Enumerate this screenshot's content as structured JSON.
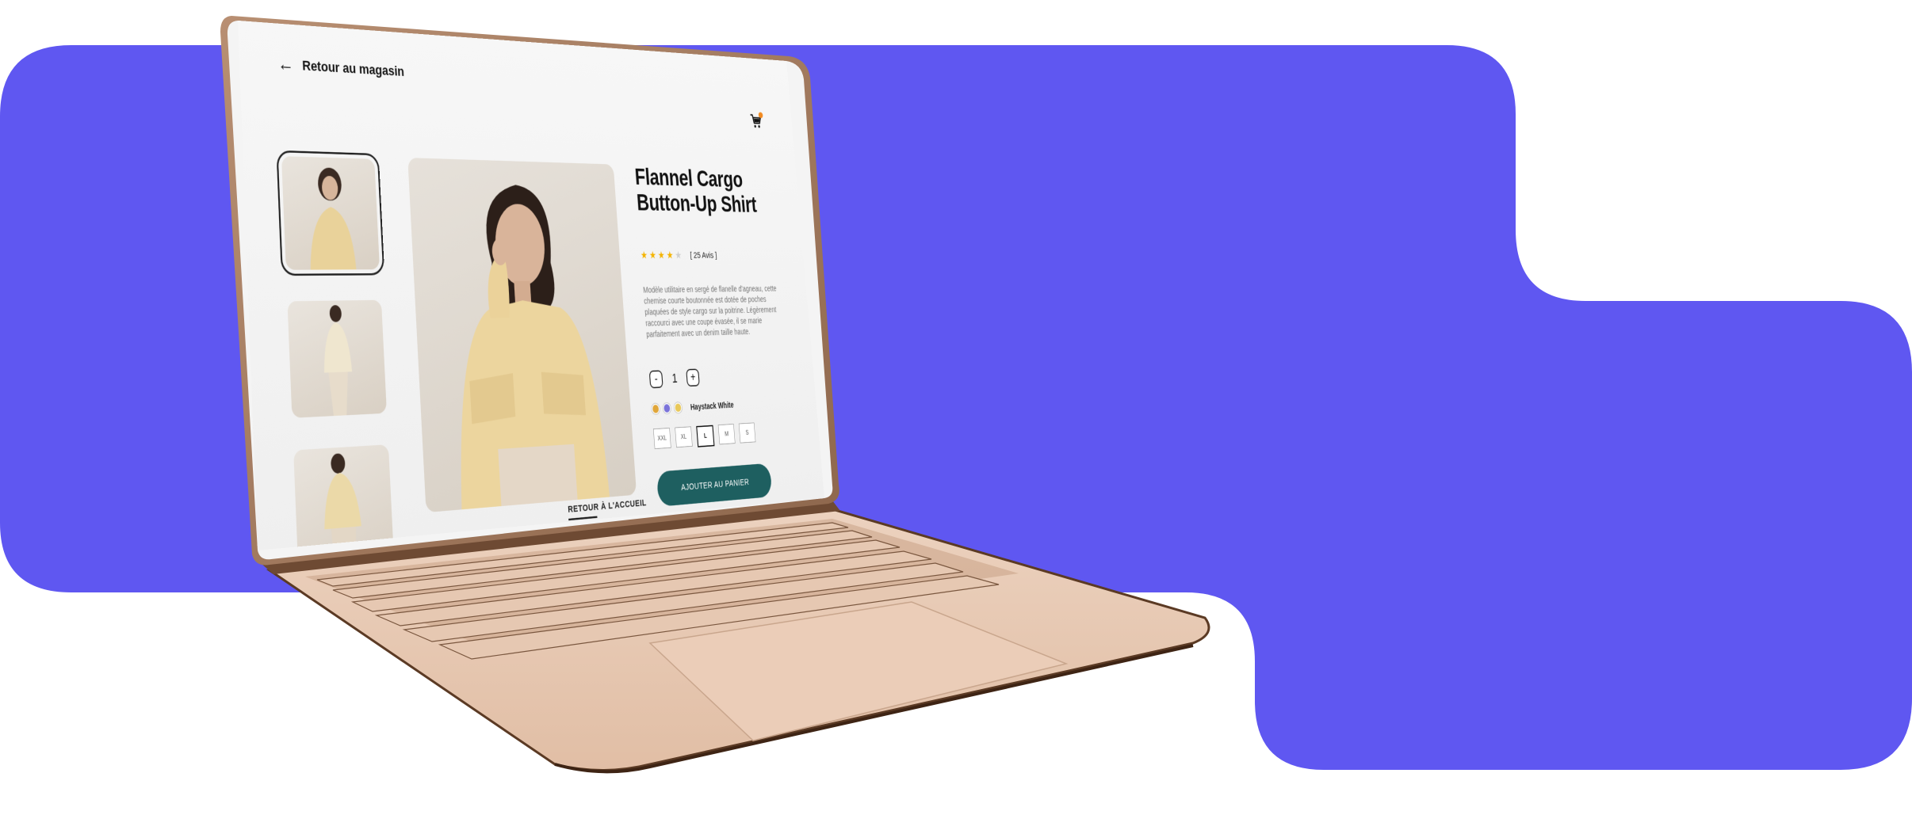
{
  "header": {
    "back_label": "Retour au magasin",
    "back_icon": "arrow-left-icon",
    "cart_icon": "shopping-cart-icon"
  },
  "product": {
    "title": "Flannel Cargo Button-Up Shirt",
    "rating": 4,
    "rating_max": 5,
    "reviews_label": "[ 25 Avis ]",
    "description": "Modèle utilitaire en sergé de flanelle d'agneau, cette chemise courte boutonnée est dotée de poches plaquées de style cargo sur la poitrine. Légèrement raccourci avec une coupe évasée, il se marie parfaitement avec un denim taille haute.",
    "quantity": "1",
    "qty_minus": "-",
    "qty_plus": "+",
    "colors": [
      "#e0a63a",
      "#7a73d9",
      "#e8c85a"
    ],
    "color_name": "Haystack White",
    "sizes": [
      "XXL",
      "XL",
      "L",
      "M",
      "S"
    ],
    "selected_size": "L",
    "add_to_cart_label": "AJOUTER AU PANIER"
  },
  "footer": {
    "home_label": "RETOUR À L'ACCUEIL"
  },
  "colors": {
    "background_shape": "#5f57f1",
    "cta_button": "#1e5f60",
    "laptop_gold": "#e3c3ab",
    "star": "#f4b400"
  }
}
